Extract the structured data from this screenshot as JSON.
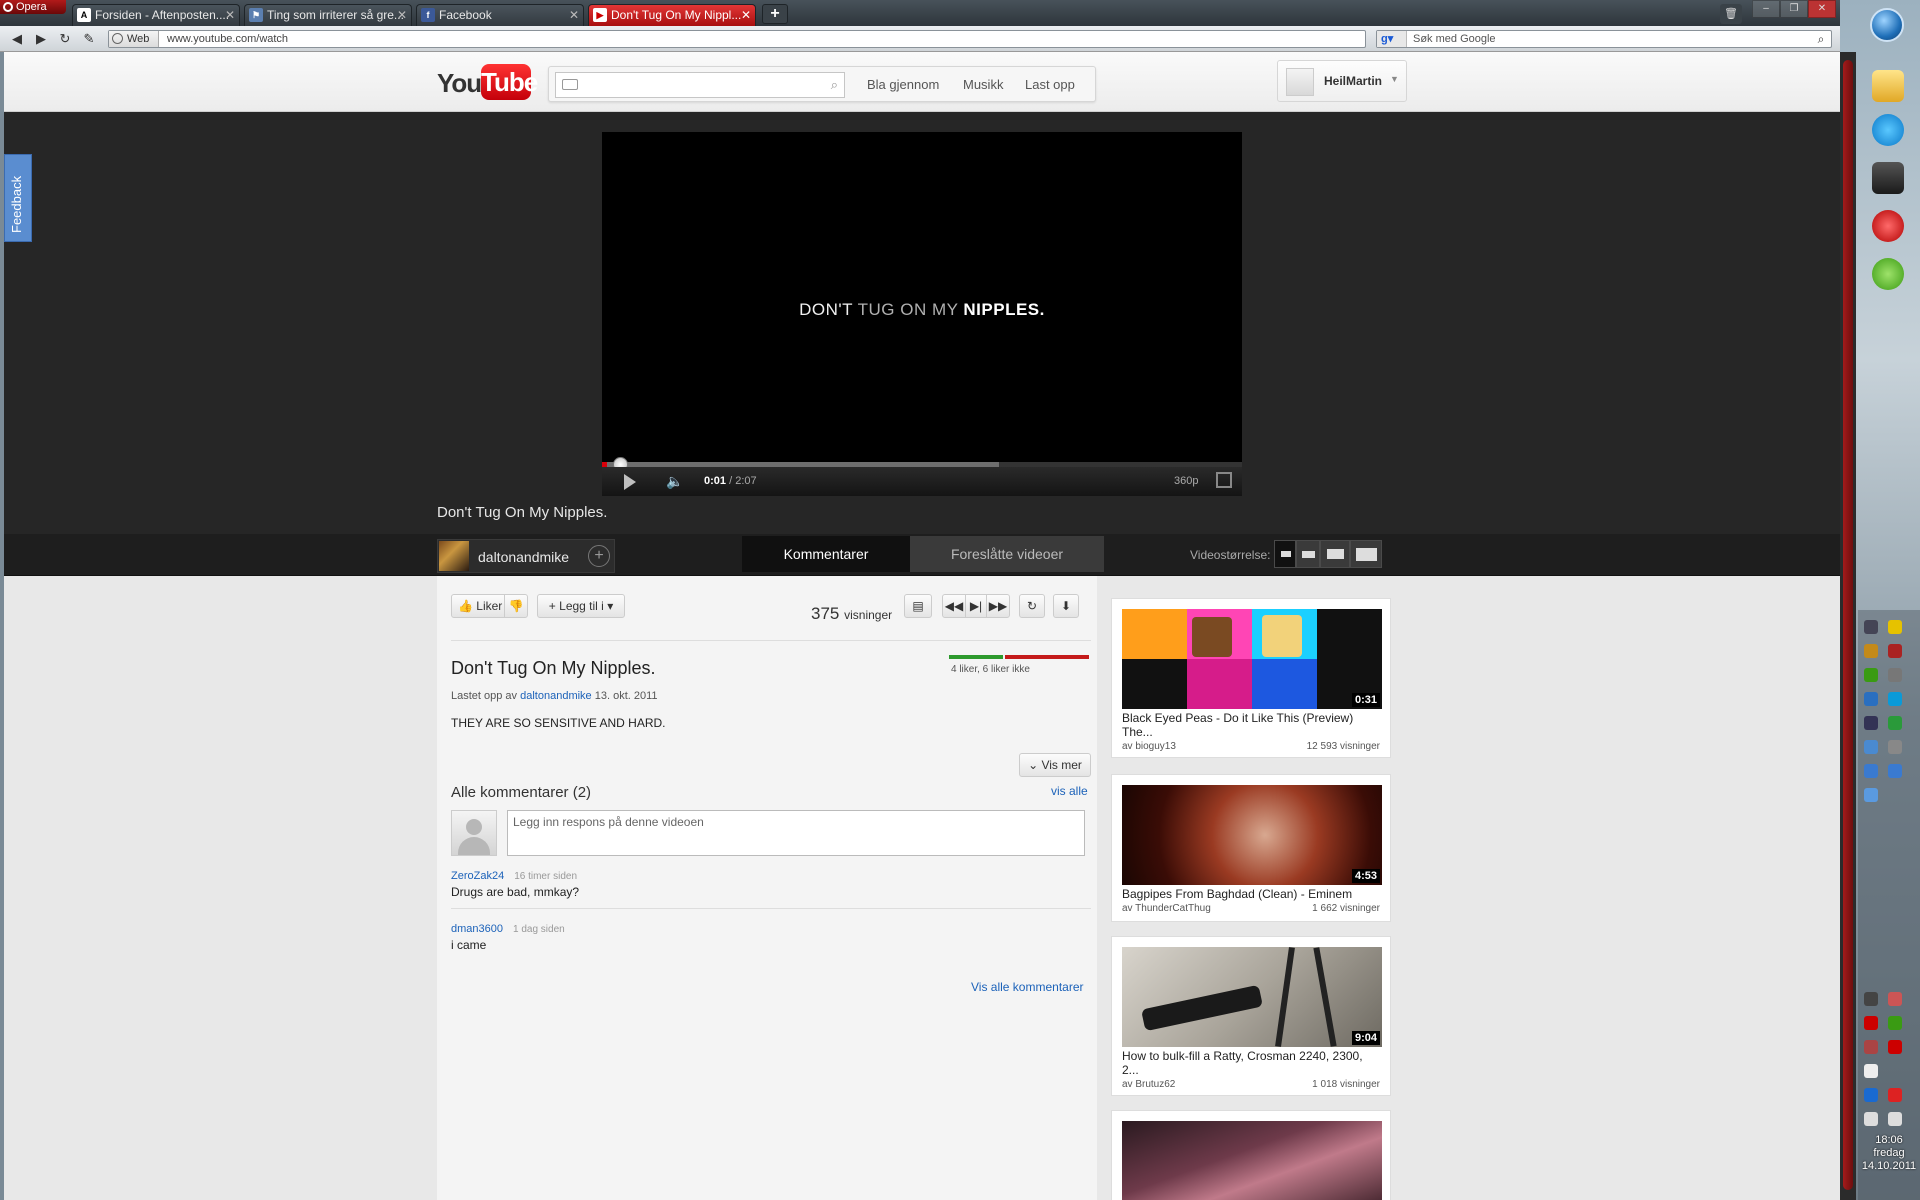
{
  "browser": {
    "app_name": "Opera",
    "tabs": [
      {
        "label": "Forsiden - Aftenposten....",
        "active": false
      },
      {
        "label": "Ting som irriterer så gre...",
        "active": false
      },
      {
        "label": "Facebook",
        "active": false
      },
      {
        "label": "Don't Tug On My Nippl...",
        "active": true
      }
    ],
    "new_tab": "+",
    "url_prefix": "Web",
    "url": "www.youtube.com/watch",
    "search_placeholder": "Søk med Google"
  },
  "youtube": {
    "logo_you": "You",
    "logo_tube": "Tube",
    "nav": [
      "Bla gjennom",
      "Musikk",
      "Last opp"
    ],
    "user": "HeilMartin",
    "feedback": "Feedback"
  },
  "player": {
    "caption_a": "DON'T ",
    "caption_b": "TUG ON MY ",
    "caption_c": "NIPPLES.",
    "time_current": "0:01",
    "time_total": " / 2:07",
    "quality": "360p",
    "played_fraction": 0.008,
    "loaded_fraction": 0.62
  },
  "video": {
    "title": "Don't Tug On My Nipples.",
    "channel": "daltonandmike",
    "tab_comments": "Kommentarer",
    "tab_suggested": "Foreslåtte videoer",
    "size_label": "Videostørrelse:",
    "like_label": "Liker",
    "add_to_label": "Legg til i",
    "views": "375",
    "views_word": "visninger",
    "rating_text": "4 liker, 6 liker ikke",
    "likes": 4,
    "dislikes": 6,
    "uploaded_prefix": "Lastet opp av",
    "uploaded_by": "daltonandmike",
    "uploaded_date": "13. okt. 2011",
    "description": "THEY ARE SO SENSITIVE AND HARD.",
    "show_more": "Vis mer"
  },
  "comments": {
    "header": "Alle kommentarer (2)",
    "see_all": "vis alle",
    "input_placeholder": "Legg inn respons på denne videoen",
    "items": [
      {
        "author": "ZeroZak24",
        "ago": "16 timer siden",
        "text": "Drugs are bad, mmkay?"
      },
      {
        "author": "dman3600",
        "ago": "1 dag siden",
        "text": "i came"
      }
    ],
    "all_link": "Vis alle kommentarer"
  },
  "suggested": [
    {
      "title": "Black Eyed Peas - Do it Like This (Preview) The...",
      "by": "av bioguy13",
      "views": "12 593 visninger",
      "duration": "0:31"
    },
    {
      "title": "Bagpipes From Baghdad (Clean) - Eminem",
      "by": "av ThunderCatThug",
      "views": "1 662 visninger",
      "duration": "4:53"
    },
    {
      "title": "How to bulk-fill a Ratty, Crosman 2240, 2300, 2...",
      "by": "av Brutuz62",
      "views": "1 018 visninger",
      "duration": "9:04"
    }
  ],
  "system": {
    "time": "18:06",
    "day": "fredag",
    "date": "14.10.2011"
  },
  "colors": {
    "youtube_red": "#cc0000",
    "link_blue": "#1c62b9",
    "like_green": "#2d9a2d",
    "dislike_red": "#c41a1a"
  }
}
